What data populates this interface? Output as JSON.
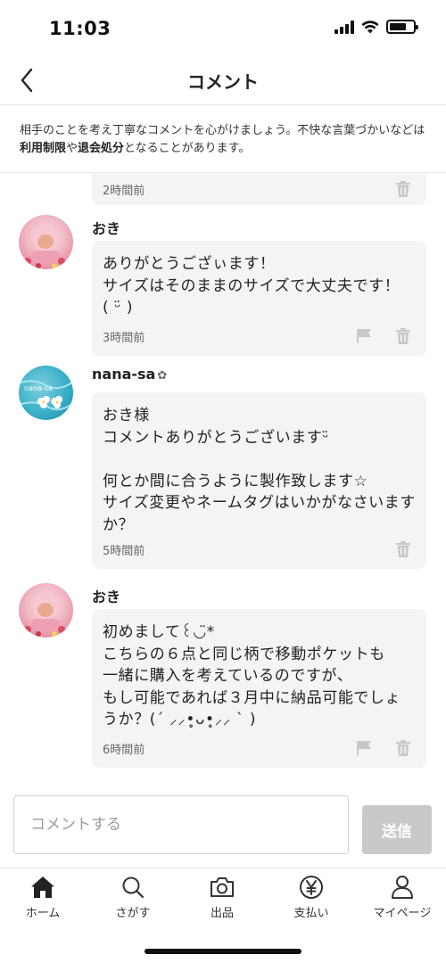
{
  "status_bar": {
    "time": "11:03"
  },
  "header": {
    "title": "コメント"
  },
  "notice": {
    "part1": "相手のことを考え丁寧なコメントを心がけましょう。不快な言葉づかいなどは",
    "bold1": "利用制限",
    "part2": "や",
    "bold2": "退会処分",
    "part3": "となることがあります。"
  },
  "comments": [
    {
      "timestamp": "2時間前"
    },
    {
      "username": "おき",
      "text": "ありがとうござぃます！\nサイズはそのままのサイズで大丈夫です！\n( ᵕ̈ )",
      "timestamp": "3時間前"
    },
    {
      "username": "nana-sa",
      "verified_badge": "✿",
      "avatar_text": "nana-sa",
      "text": "おき様\nコメントありがとうございますᵕ̈\n\n何とか間に合うように製作致します☆\nサイズ変更やネームタグはいかがなさいますか？",
      "timestamp": "5時間前"
    },
    {
      "username": "おき",
      "text": "初めまして꒰◡̈*\nこちらの６点と同じ柄で移動ポケットも\n一緒に購入を考えているのですが、\nもし可能であれば３月中に納品可能でしょうか？(´ ⸝⸝•̥ᴗ•̥⸝⸝ ` )",
      "timestamp": "6時間前"
    }
  ],
  "comment_input": {
    "placeholder": "コメントする",
    "send_label": "送信"
  },
  "tabs": [
    {
      "label": "ホーム",
      "icon": "home-icon"
    },
    {
      "label": "さがす",
      "icon": "search-icon"
    },
    {
      "label": "出品",
      "icon": "camera-icon"
    },
    {
      "label": "支払い",
      "icon": "yen-icon"
    },
    {
      "label": "マイページ",
      "icon": "person-icon"
    }
  ],
  "colors": {
    "bubble": "#f4f4f4",
    "send_disabled": "#c9c9c9",
    "icon_gray": "#c8c8c8"
  }
}
